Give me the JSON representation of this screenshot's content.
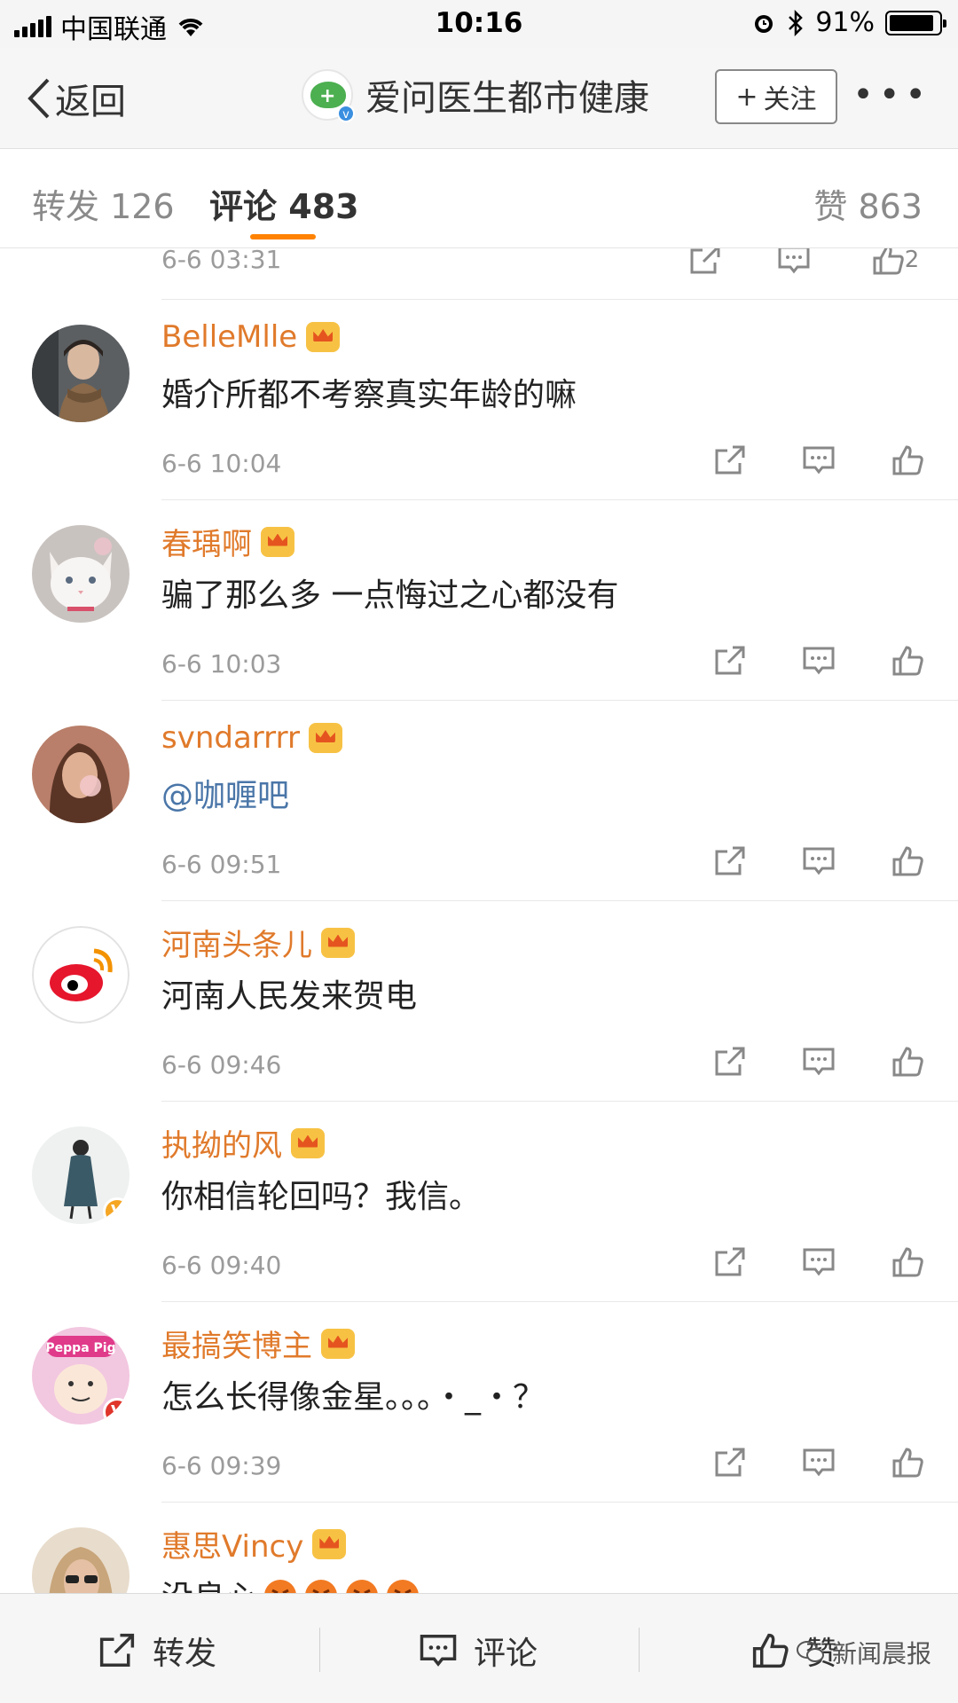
{
  "status_bar": {
    "carrier": "中国联通",
    "time": "10:16",
    "battery": "91%",
    "battery_level": 0.91
  },
  "nav": {
    "back_label": "返回",
    "title": "爱问医生都市健康",
    "follow_label": "关注",
    "more_label": "•••"
  },
  "tabs": {
    "repost": "转发 126",
    "comments_label": "评论",
    "comments_count": "483",
    "likes": "赞 863"
  },
  "partial_row": {
    "time": "6-6 03:31",
    "like_count": "2"
  },
  "comments": [
    {
      "user": "BelleMlle",
      "text": "婚介所都不考察真实年龄的嘛",
      "time": "6-6 10:04",
      "mention": false,
      "avatar": "woman-scarf-photo",
      "badge": null
    },
    {
      "user": "春瑀啊",
      "text": "骗了那么多 一点悔过之心都没有",
      "time": "6-6 10:03",
      "mention": false,
      "avatar": "white-cat-photo",
      "badge": null
    },
    {
      "user": "svndarrrr",
      "text": "@咖喱吧",
      "time": "6-6 09:51",
      "mention": true,
      "avatar": "woman-bubblegum-photo",
      "badge": null
    },
    {
      "user": "河南头条儿",
      "text": "河南人民发来贺电",
      "time": "6-6 09:46",
      "mention": false,
      "avatar": "weibo-logo",
      "badge": null
    },
    {
      "user": "执拗的风",
      "text": "你相信轮回吗？我信。",
      "time": "6-6 09:40",
      "mention": false,
      "avatar": "illustrated-girl",
      "badge": "V"
    },
    {
      "user": "最搞笑博主",
      "text": "怎么长得像金星。。。・_・？",
      "time": "6-6 09:39",
      "mention": false,
      "avatar": "peppa-pig-meme",
      "badge": "V"
    },
    {
      "user": "惠思Vincy",
      "text": "没良心",
      "time": "",
      "mention": false,
      "avatar": "woman-sunglasses-photo",
      "badge": null
    }
  ],
  "bottom_bar": {
    "repost": "转发",
    "comment": "评论",
    "like": "赞",
    "watermark": "新闻晨报"
  },
  "colors": {
    "username": "#e07a2b",
    "tab_accent": "#ff8200",
    "mention": "#4a76a8",
    "crown": "#f7c244"
  }
}
